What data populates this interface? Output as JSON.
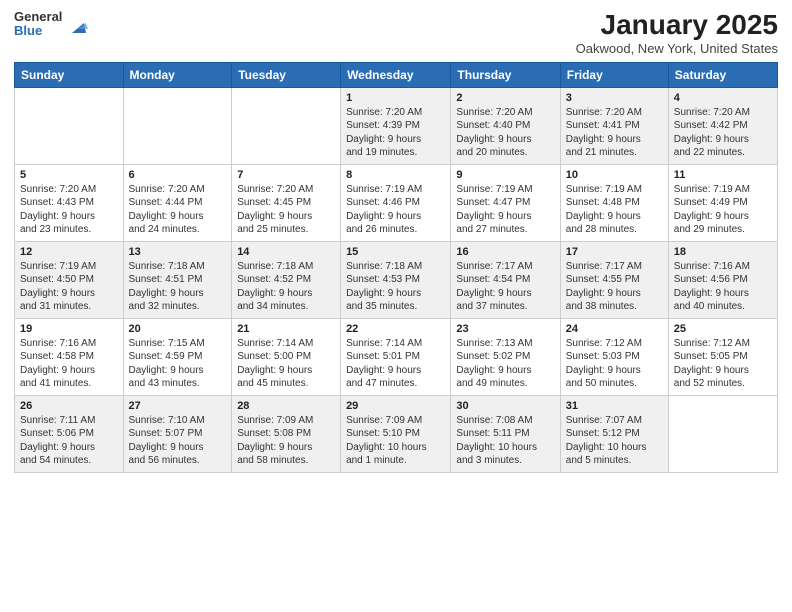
{
  "header": {
    "logo_general": "General",
    "logo_blue": "Blue",
    "title": "January 2025",
    "subtitle": "Oakwood, New York, United States"
  },
  "weekdays": [
    "Sunday",
    "Monday",
    "Tuesday",
    "Wednesday",
    "Thursday",
    "Friday",
    "Saturday"
  ],
  "weeks": [
    [
      {
        "day": "",
        "info": ""
      },
      {
        "day": "",
        "info": ""
      },
      {
        "day": "",
        "info": ""
      },
      {
        "day": "1",
        "info": "Sunrise: 7:20 AM\nSunset: 4:39 PM\nDaylight: 9 hours\nand 19 minutes."
      },
      {
        "day": "2",
        "info": "Sunrise: 7:20 AM\nSunset: 4:40 PM\nDaylight: 9 hours\nand 20 minutes."
      },
      {
        "day": "3",
        "info": "Sunrise: 7:20 AM\nSunset: 4:41 PM\nDaylight: 9 hours\nand 21 minutes."
      },
      {
        "day": "4",
        "info": "Sunrise: 7:20 AM\nSunset: 4:42 PM\nDaylight: 9 hours\nand 22 minutes."
      }
    ],
    [
      {
        "day": "5",
        "info": "Sunrise: 7:20 AM\nSunset: 4:43 PM\nDaylight: 9 hours\nand 23 minutes."
      },
      {
        "day": "6",
        "info": "Sunrise: 7:20 AM\nSunset: 4:44 PM\nDaylight: 9 hours\nand 24 minutes."
      },
      {
        "day": "7",
        "info": "Sunrise: 7:20 AM\nSunset: 4:45 PM\nDaylight: 9 hours\nand 25 minutes."
      },
      {
        "day": "8",
        "info": "Sunrise: 7:19 AM\nSunset: 4:46 PM\nDaylight: 9 hours\nand 26 minutes."
      },
      {
        "day": "9",
        "info": "Sunrise: 7:19 AM\nSunset: 4:47 PM\nDaylight: 9 hours\nand 27 minutes."
      },
      {
        "day": "10",
        "info": "Sunrise: 7:19 AM\nSunset: 4:48 PM\nDaylight: 9 hours\nand 28 minutes."
      },
      {
        "day": "11",
        "info": "Sunrise: 7:19 AM\nSunset: 4:49 PM\nDaylight: 9 hours\nand 29 minutes."
      }
    ],
    [
      {
        "day": "12",
        "info": "Sunrise: 7:19 AM\nSunset: 4:50 PM\nDaylight: 9 hours\nand 31 minutes."
      },
      {
        "day": "13",
        "info": "Sunrise: 7:18 AM\nSunset: 4:51 PM\nDaylight: 9 hours\nand 32 minutes."
      },
      {
        "day": "14",
        "info": "Sunrise: 7:18 AM\nSunset: 4:52 PM\nDaylight: 9 hours\nand 34 minutes."
      },
      {
        "day": "15",
        "info": "Sunrise: 7:18 AM\nSunset: 4:53 PM\nDaylight: 9 hours\nand 35 minutes."
      },
      {
        "day": "16",
        "info": "Sunrise: 7:17 AM\nSunset: 4:54 PM\nDaylight: 9 hours\nand 37 minutes."
      },
      {
        "day": "17",
        "info": "Sunrise: 7:17 AM\nSunset: 4:55 PM\nDaylight: 9 hours\nand 38 minutes."
      },
      {
        "day": "18",
        "info": "Sunrise: 7:16 AM\nSunset: 4:56 PM\nDaylight: 9 hours\nand 40 minutes."
      }
    ],
    [
      {
        "day": "19",
        "info": "Sunrise: 7:16 AM\nSunset: 4:58 PM\nDaylight: 9 hours\nand 41 minutes."
      },
      {
        "day": "20",
        "info": "Sunrise: 7:15 AM\nSunset: 4:59 PM\nDaylight: 9 hours\nand 43 minutes."
      },
      {
        "day": "21",
        "info": "Sunrise: 7:14 AM\nSunset: 5:00 PM\nDaylight: 9 hours\nand 45 minutes."
      },
      {
        "day": "22",
        "info": "Sunrise: 7:14 AM\nSunset: 5:01 PM\nDaylight: 9 hours\nand 47 minutes."
      },
      {
        "day": "23",
        "info": "Sunrise: 7:13 AM\nSunset: 5:02 PM\nDaylight: 9 hours\nand 49 minutes."
      },
      {
        "day": "24",
        "info": "Sunrise: 7:12 AM\nSunset: 5:03 PM\nDaylight: 9 hours\nand 50 minutes."
      },
      {
        "day": "25",
        "info": "Sunrise: 7:12 AM\nSunset: 5:05 PM\nDaylight: 9 hours\nand 52 minutes."
      }
    ],
    [
      {
        "day": "26",
        "info": "Sunrise: 7:11 AM\nSunset: 5:06 PM\nDaylight: 9 hours\nand 54 minutes."
      },
      {
        "day": "27",
        "info": "Sunrise: 7:10 AM\nSunset: 5:07 PM\nDaylight: 9 hours\nand 56 minutes."
      },
      {
        "day": "28",
        "info": "Sunrise: 7:09 AM\nSunset: 5:08 PM\nDaylight: 9 hours\nand 58 minutes."
      },
      {
        "day": "29",
        "info": "Sunrise: 7:09 AM\nSunset: 5:10 PM\nDaylight: 10 hours\nand 1 minute."
      },
      {
        "day": "30",
        "info": "Sunrise: 7:08 AM\nSunset: 5:11 PM\nDaylight: 10 hours\nand 3 minutes."
      },
      {
        "day": "31",
        "info": "Sunrise: 7:07 AM\nSunset: 5:12 PM\nDaylight: 10 hours\nand 5 minutes."
      },
      {
        "day": "",
        "info": ""
      }
    ]
  ],
  "accent_color": "#2a6db5",
  "shaded_rows": [
    0,
    2,
    4
  ]
}
